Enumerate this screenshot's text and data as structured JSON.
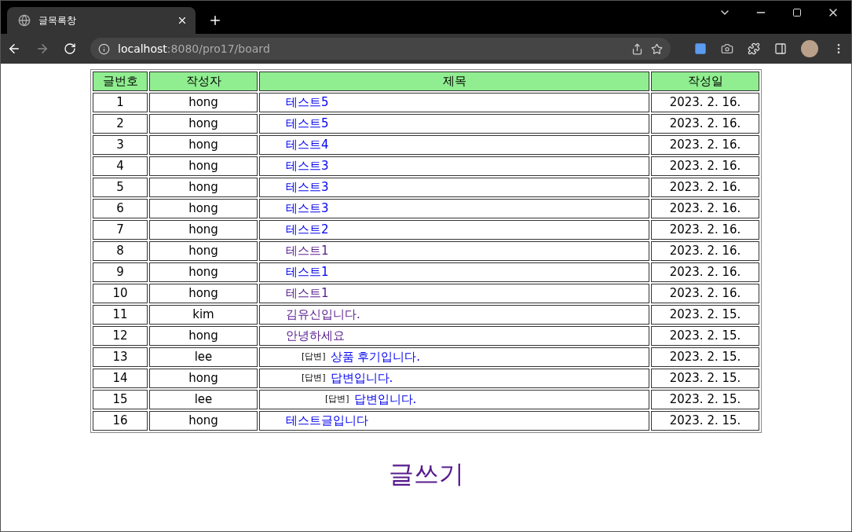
{
  "browser": {
    "tab_title": "글목록창",
    "url_host": "localhost",
    "url_path": ":8080/pro17/board"
  },
  "table": {
    "columns": [
      "글번호",
      "작성자",
      "제목",
      "작성일"
    ],
    "rows": [
      {
        "no": "1",
        "author": "hong",
        "title": "테스트5",
        "visited": false,
        "date": "2023. 2. 16."
      },
      {
        "no": "2",
        "author": "hong",
        "title": "테스트5",
        "visited": false,
        "date": "2023. 2. 16."
      },
      {
        "no": "3",
        "author": "hong",
        "title": "테스트4",
        "visited": false,
        "date": "2023. 2. 16."
      },
      {
        "no": "4",
        "author": "hong",
        "title": "테스트3",
        "visited": false,
        "date": "2023. 2. 16."
      },
      {
        "no": "5",
        "author": "hong",
        "title": "테스트3",
        "visited": false,
        "date": "2023. 2. 16."
      },
      {
        "no": "6",
        "author": "hong",
        "title": "테스트3",
        "visited": false,
        "date": "2023. 2. 16."
      },
      {
        "no": "7",
        "author": "hong",
        "title": "테스트2",
        "visited": false,
        "date": "2023. 2. 16."
      },
      {
        "no": "8",
        "author": "hong",
        "title": "테스트1",
        "visited": true,
        "date": "2023. 2. 16."
      },
      {
        "no": "9",
        "author": "hong",
        "title": "테스트1",
        "visited": false,
        "date": "2023. 2. 16."
      },
      {
        "no": "10",
        "author": "hong",
        "title": "테스트1",
        "visited": true,
        "date": "2023. 2. 16."
      },
      {
        "no": "11",
        "author": "kim",
        "title": "김유신입니다.",
        "visited": true,
        "date": "2023. 2. 15."
      },
      {
        "no": "12",
        "author": "hong",
        "title": "안녕하세요",
        "visited": true,
        "date": "2023. 2. 15.",
        "children": [
          {
            "no": "13",
            "author": "lee",
            "reply_tag": "[답변]",
            "title": "상품 후기입니다.",
            "visited": false,
            "date": "2023. 2. 15."
          },
          {
            "no": "14",
            "author": "hong",
            "reply_tag": "[답변]",
            "title": "답변입니다.",
            "visited": false,
            "date": "2023. 2. 15.",
            "children": [
              {
                "no": "15",
                "author": "lee",
                "reply_tag": "[답변]",
                "title": "답변입니다.",
                "visited": false,
                "date": "2023. 2. 15."
              }
            ]
          }
        ]
      },
      {
        "no": "16",
        "author": "hong",
        "title": "테스트글입니다",
        "visited": false,
        "date": "2023. 2. 15."
      }
    ]
  },
  "write_link": {
    "label": "글쓰기",
    "visited": true
  }
}
